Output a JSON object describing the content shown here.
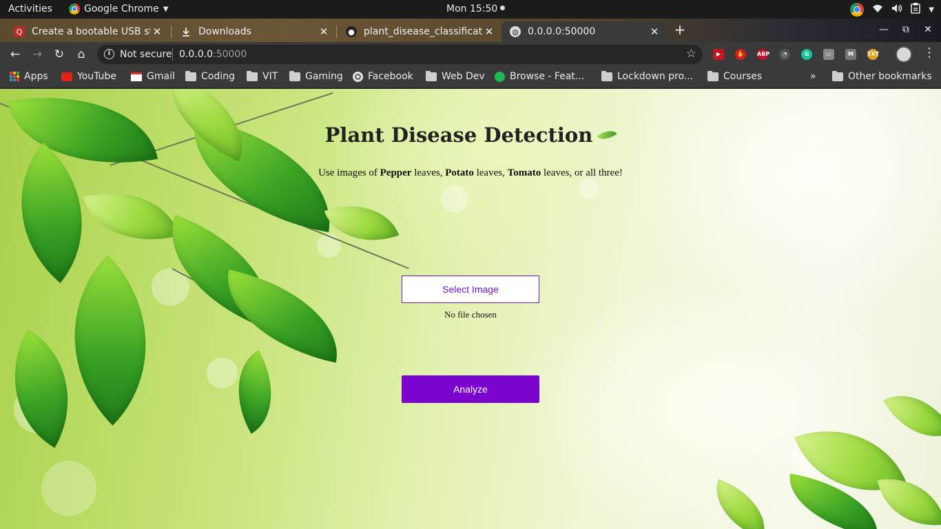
{
  "os": {
    "activities": "Activities",
    "app_name": "Google Chrome",
    "clock": "Mon 15:50"
  },
  "tabs": [
    {
      "title": "Create a bootable USB sti",
      "favicon": "quora-icon",
      "active": false
    },
    {
      "title": "Downloads",
      "favicon": "download-icon",
      "active": false
    },
    {
      "title": "plant_disease_classificati",
      "favicon": "github-icon",
      "active": false
    },
    {
      "title": "0.0.0.0:50000",
      "favicon": "globe-icon",
      "active": true
    }
  ],
  "toolbar": {
    "security_label": "Not secure",
    "url_host": "0.0.0.0",
    "url_port": ":50000"
  },
  "bookmarks": {
    "items": [
      {
        "label": "Apps",
        "icon": "apps-icon"
      },
      {
        "label": "YouTube",
        "icon": "youtube-icon"
      },
      {
        "label": "Gmail",
        "icon": "gmail-icon"
      },
      {
        "label": "Coding",
        "icon": "folder-icon"
      },
      {
        "label": "VIT",
        "icon": "folder-icon"
      },
      {
        "label": "Gaming",
        "icon": "folder-icon"
      },
      {
        "label": "Facebook",
        "icon": "globe-icon"
      },
      {
        "label": "Web Dev",
        "icon": "folder-icon"
      },
      {
        "label": "Browse - Feat...",
        "icon": "spotify-icon"
      },
      {
        "label": "Lockdown pro...",
        "icon": "folder-icon"
      },
      {
        "label": "Courses",
        "icon": "folder-icon"
      }
    ],
    "overflow": "»",
    "other": "Other bookmarks"
  },
  "page": {
    "title": "Plant Disease Detection",
    "subtitle": {
      "prefix": "Use images of ",
      "plant1": "Pepper",
      "mid1": " leaves, ",
      "plant2": "Potato",
      "mid2": " leaves, ",
      "plant3": "Tomato",
      "suffix": " leaves, or all three!"
    },
    "select_button": "Select Image",
    "file_status": "No file chosen",
    "analyze_button": "Analyze"
  },
  "colors": {
    "accent_purple": "#7b05cf",
    "select_border": "#6a16c7",
    "browser_dark": "#3a3a3a"
  }
}
